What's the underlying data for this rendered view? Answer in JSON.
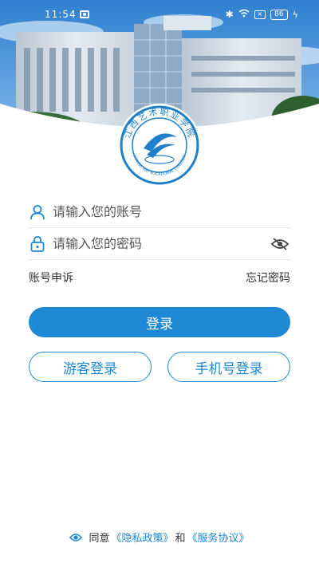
{
  "status_bar": {
    "time": "11:54",
    "battery": "86",
    "icons": [
      "camera-icon",
      "bluetooth-icon",
      "wifi-icon",
      "sim-x-icon",
      "battery-icon",
      "charging-icon"
    ]
  },
  "header": {
    "logo_text": "江西艺术职业学院",
    "logo_subtext": "JIANGXI ART VOCATIONAL COLLEGE"
  },
  "login_form": {
    "username_placeholder": "请输入您的账号",
    "password_placeholder": "请输入您的密码",
    "account_appeal": "账号申诉",
    "forgot_password": "忘记密码",
    "login_button": "登录",
    "guest_login": "游客登录",
    "phone_login": "手机号登录"
  },
  "agreement": {
    "agree_text": "同意",
    "privacy_policy": "《隐私政策》",
    "and_text": "和",
    "service_agreement": "《服务协议》"
  },
  "colors": {
    "accent": "#1e88d4",
    "sky": "#3d8fd6",
    "logo_blue": "#1f7fc8"
  }
}
